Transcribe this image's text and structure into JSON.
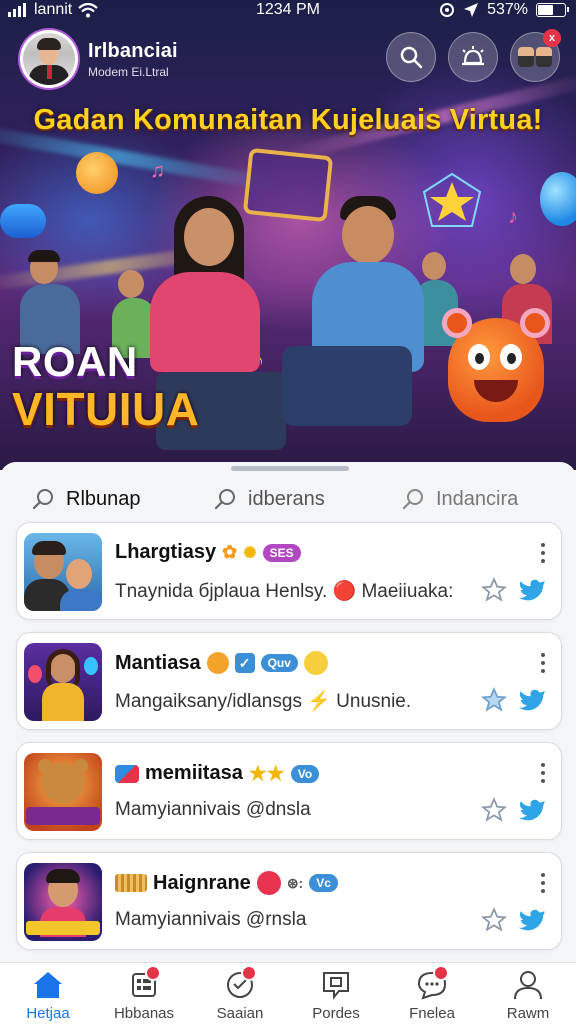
{
  "status_bar": {
    "carrier": "lannit",
    "time": "1234 PM",
    "battery": "537%",
    "battery_level": 0.52
  },
  "profile": {
    "name": "Irlbanciai",
    "subtitle": "Modem Ei.Ltral"
  },
  "header_actions": {
    "notification_count": "x"
  },
  "hero": {
    "headline": "Gadan Komunaitan Kujeluais Virtua!",
    "logo_line1": "ROAN",
    "logo_line2": "VITUIUA"
  },
  "tabs": [
    {
      "label": "Rlbunap",
      "active": true
    },
    {
      "label": "idberans",
      "active": false
    },
    {
      "label": "Indancira",
      "active": false
    }
  ],
  "cards": [
    {
      "title": "Lhargtiasy",
      "chip": "SES",
      "chip_color": "#b347c2",
      "subtitle": "Tnaynida бjplaua Henlsy. 🔴 Maeiiuaka:"
    },
    {
      "title": "Mantiasa",
      "chip": "Quv",
      "chip_color": "#3a8fd6",
      "subtitle": "Mangaiksany/idlansgs ⚡ Unusnie."
    },
    {
      "title": "memiitasa",
      "chip": "Vo",
      "chip_color": "#3a8fd6",
      "subtitle": "Mamyiannivais @dnsla"
    },
    {
      "title": "Haignrane",
      "chip": "Vc",
      "chip_color": "#3a8fd6",
      "subtitle": "Mamyiannivais @rnsla"
    }
  ],
  "bottom_nav": [
    {
      "label": "Hetjaa",
      "icon": "home-icon",
      "active": true
    },
    {
      "label": "Hbbanas",
      "icon": "grid-icon",
      "active": false
    },
    {
      "label": "Saaian",
      "icon": "heart-chat-icon",
      "active": false
    },
    {
      "label": "Pordes",
      "icon": "message-square-icon",
      "active": false
    },
    {
      "label": "Fnelea",
      "icon": "chat-bubble-icon",
      "active": false
    },
    {
      "label": "Rawm",
      "icon": "profile-icon",
      "active": false
    }
  ],
  "colors": {
    "accent": "#1a73e8",
    "headline": "#ffd21f",
    "badge": "#e6334a"
  }
}
